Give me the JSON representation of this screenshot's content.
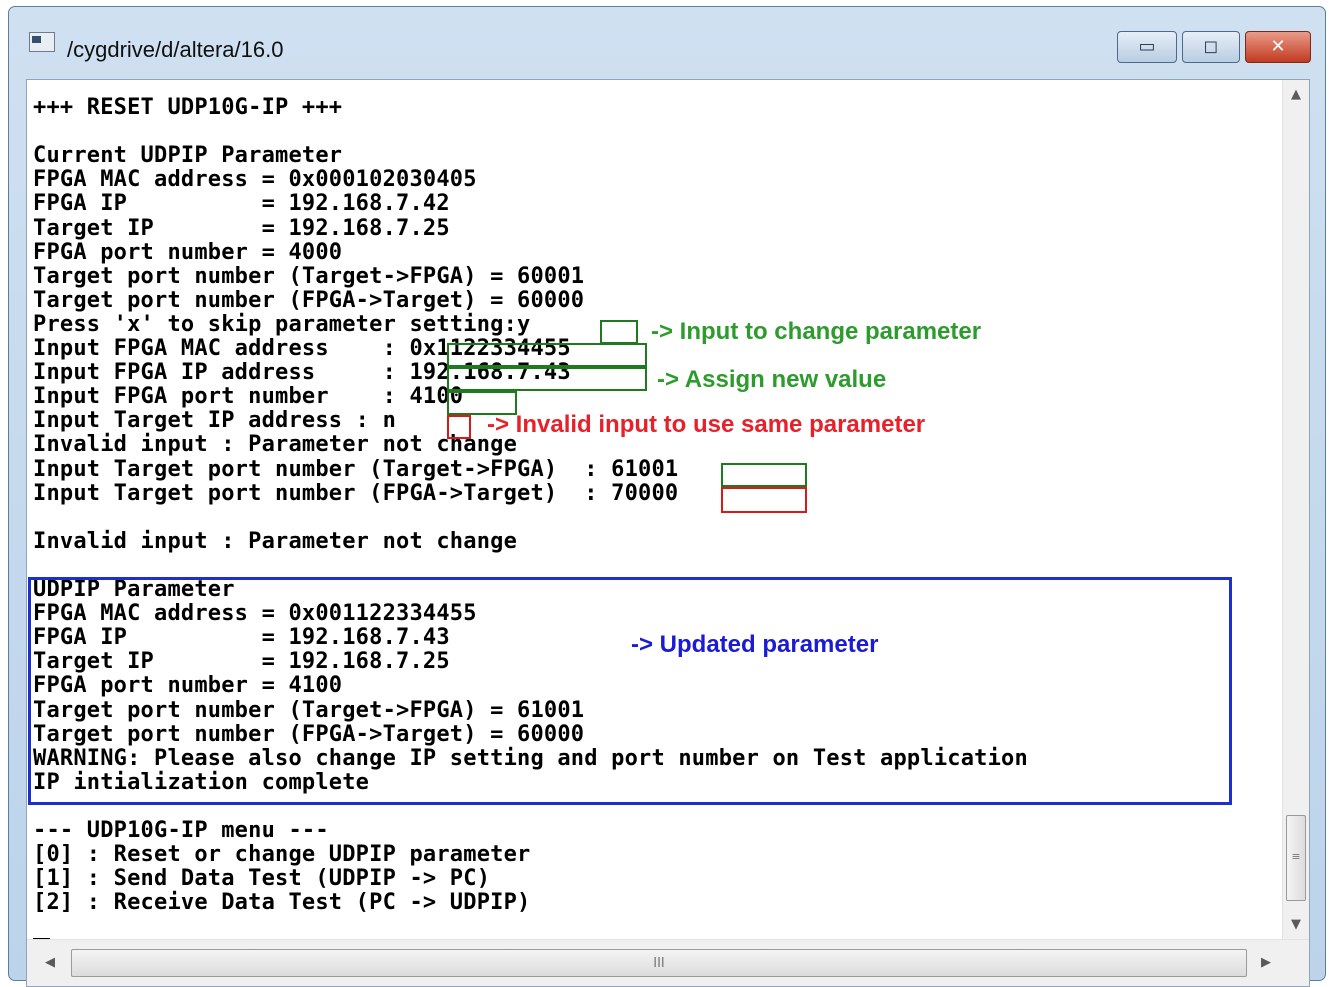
{
  "window": {
    "title": "/cygdrive/d/altera/16.0",
    "minimize_glyph": "▭",
    "maximize_glyph": "◻",
    "close_glyph": "✕"
  },
  "console_lines": [
    "+++ RESET UDP10G-IP +++",
    "",
    "Current UDPIP Parameter",
    "FPGA MAC address = 0x000102030405",
    "FPGA IP          = 192.168.7.42",
    "Target IP        = 192.168.7.25",
    "FPGA port number = 4000",
    "Target port number (Target->FPGA) = 60001",
    "Target port number (FPGA->Target) = 60000",
    "Press 'x' to skip parameter setting:y",
    "Input FPGA MAC address    : 0x1122334455",
    "Input FPGA IP address     : 192.168.7.43",
    "Input FPGA port number    : 4100",
    "Input Target IP address : n",
    "Invalid input : Parameter not change",
    "Input Target port number (Target->FPGA)  : 61001",
    "Input Target port number (FPGA->Target)  : 70000",
    "",
    "Invalid input : Parameter not change",
    "",
    "UDPIP Parameter",
    "FPGA MAC address = 0x001122334455",
    "FPGA IP          = 192.168.7.43",
    "Target IP        = 192.168.7.25",
    "FPGA port number = 4100",
    "Target port number (Target->FPGA) = 61001",
    "Target port number (FPGA->Target) = 60000",
    "WARNING: Please also change IP setting and port number on Test application",
    "IP intialization complete",
    "",
    "--- UDP10G-IP menu ---",
    "[0] : Reset or change UDPIP parameter",
    "[1] : Send Data Test (UDPIP -> PC)",
    "[2] : Receive Data Test (PC -> UDPIP)"
  ],
  "annotations": {
    "input_change": "-> Input to change parameter",
    "assign_value": "-> Assign new value",
    "invalid_input": "-> Invalid input to use same parameter",
    "updated": "-> Updated parameter"
  },
  "colors": {
    "green": "#2e9b2e",
    "red": "#e8202a",
    "blue": "#1b1bd6",
    "box_green": "#1f7a1f",
    "box_red": "#d81a1a",
    "box_blue": "#1d2fd0"
  },
  "scrollbar": {
    "up_arrow": "▲",
    "down_arrow": "▼",
    "left_arrow": "◀",
    "right_arrow": "▶",
    "grip": "≡",
    "hgrip": "III"
  }
}
